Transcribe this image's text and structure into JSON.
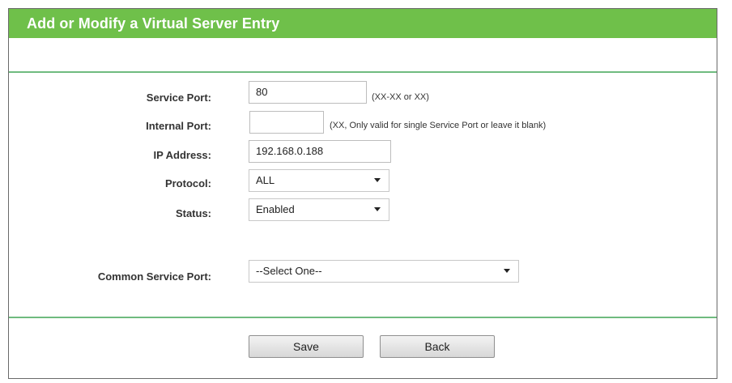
{
  "header": {
    "title": "Add or Modify a Virtual Server Entry"
  },
  "form": {
    "service_port": {
      "label": "Service Port:",
      "value": "80",
      "hint": "(XX-XX or XX)"
    },
    "internal_port": {
      "label": "Internal Port:",
      "value": "",
      "hint": "(XX, Only valid for single Service Port or leave it blank)"
    },
    "ip_address": {
      "label": "IP Address:",
      "value": "192.168.0.188"
    },
    "protocol": {
      "label": "Protocol:",
      "value": "ALL"
    },
    "status": {
      "label": "Status:",
      "value": "Enabled"
    },
    "common_service_port": {
      "label": "Common Service Port:",
      "value": "--Select One--"
    }
  },
  "buttons": {
    "save": "Save",
    "back": "Back"
  },
  "colors": {
    "header_bg": "#6fc04a",
    "rule": "#6fbb7f"
  }
}
